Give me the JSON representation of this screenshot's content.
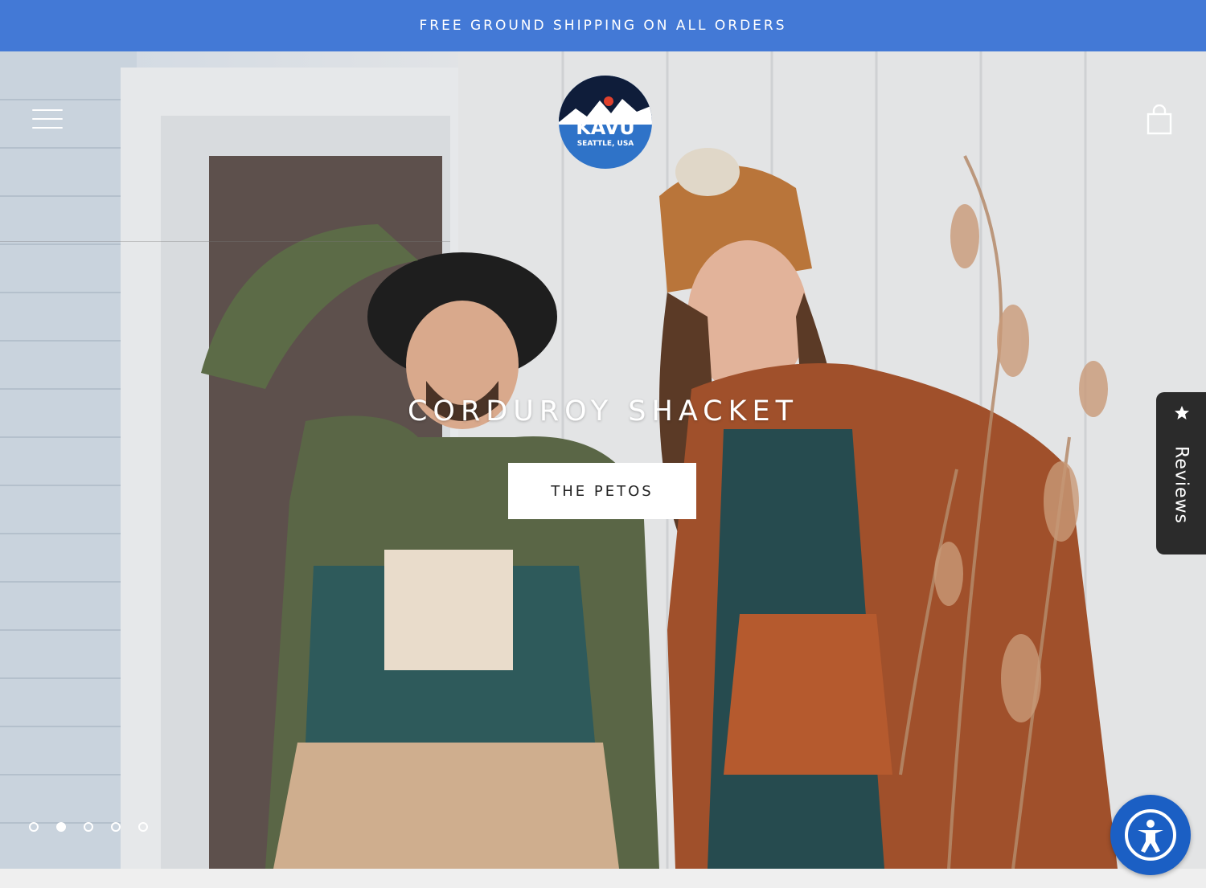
{
  "announcement": {
    "text": "FREE GROUND SHIPPING ON ALL ORDERS"
  },
  "header": {
    "logo": {
      "brand": "KAVU",
      "tagline": "SEATTLE, USA"
    },
    "menu_icon": "hamburger-icon",
    "cart_icon": "shopping-bag-icon"
  },
  "hero": {
    "title": "CORDUROY SHACKET",
    "cta_label": "THE PETOS",
    "slides_count": 5,
    "active_slide": 2
  },
  "reviews_tab": {
    "label": "Reviews",
    "icon": "star-icon"
  },
  "accessibility": {
    "icon": "accessibility-icon"
  },
  "colors": {
    "announcement_bg": "#4379d6",
    "accessibility_bg": "#1b5fc4",
    "reviews_bg": "#2b2b2b",
    "logo_blue": "#2f73c8",
    "logo_navy": "#0f1d3a",
    "logo_sun": "#e0412d"
  }
}
